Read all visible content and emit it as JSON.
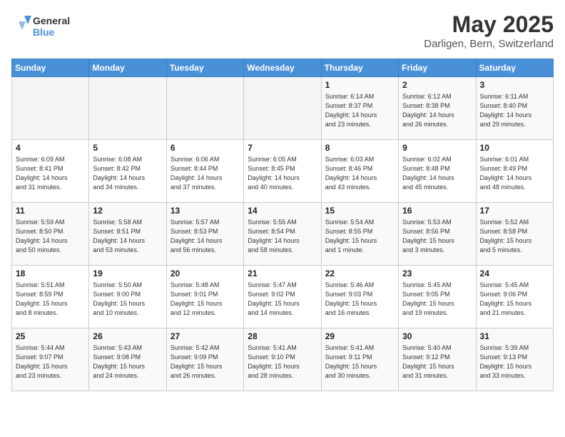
{
  "header": {
    "logo_general": "General",
    "logo_blue": "Blue",
    "month_title": "May 2025",
    "location": "Darligen, Bern, Switzerland"
  },
  "weekdays": [
    "Sunday",
    "Monday",
    "Tuesday",
    "Wednesday",
    "Thursday",
    "Friday",
    "Saturday"
  ],
  "weeks": [
    [
      {
        "day": "",
        "info": ""
      },
      {
        "day": "",
        "info": ""
      },
      {
        "day": "",
        "info": ""
      },
      {
        "day": "",
        "info": ""
      },
      {
        "day": "1",
        "info": "Sunrise: 6:14 AM\nSunset: 8:37 PM\nDaylight: 14 hours\nand 23 minutes."
      },
      {
        "day": "2",
        "info": "Sunrise: 6:12 AM\nSunset: 8:38 PM\nDaylight: 14 hours\nand 26 minutes."
      },
      {
        "day": "3",
        "info": "Sunrise: 6:11 AM\nSunset: 8:40 PM\nDaylight: 14 hours\nand 29 minutes."
      }
    ],
    [
      {
        "day": "4",
        "info": "Sunrise: 6:09 AM\nSunset: 8:41 PM\nDaylight: 14 hours\nand 31 minutes."
      },
      {
        "day": "5",
        "info": "Sunrise: 6:08 AM\nSunset: 8:42 PM\nDaylight: 14 hours\nand 34 minutes."
      },
      {
        "day": "6",
        "info": "Sunrise: 6:06 AM\nSunset: 8:44 PM\nDaylight: 14 hours\nand 37 minutes."
      },
      {
        "day": "7",
        "info": "Sunrise: 6:05 AM\nSunset: 8:45 PM\nDaylight: 14 hours\nand 40 minutes."
      },
      {
        "day": "8",
        "info": "Sunrise: 6:03 AM\nSunset: 8:46 PM\nDaylight: 14 hours\nand 43 minutes."
      },
      {
        "day": "9",
        "info": "Sunrise: 6:02 AM\nSunset: 8:48 PM\nDaylight: 14 hours\nand 45 minutes."
      },
      {
        "day": "10",
        "info": "Sunrise: 6:01 AM\nSunset: 8:49 PM\nDaylight: 14 hours\nand 48 minutes."
      }
    ],
    [
      {
        "day": "11",
        "info": "Sunrise: 5:59 AM\nSunset: 8:50 PM\nDaylight: 14 hours\nand 50 minutes."
      },
      {
        "day": "12",
        "info": "Sunrise: 5:58 AM\nSunset: 8:51 PM\nDaylight: 14 hours\nand 53 minutes."
      },
      {
        "day": "13",
        "info": "Sunrise: 5:57 AM\nSunset: 8:53 PM\nDaylight: 14 hours\nand 56 minutes."
      },
      {
        "day": "14",
        "info": "Sunrise: 5:55 AM\nSunset: 8:54 PM\nDaylight: 14 hours\nand 58 minutes."
      },
      {
        "day": "15",
        "info": "Sunrise: 5:54 AM\nSunset: 8:55 PM\nDaylight: 15 hours\nand 1 minute."
      },
      {
        "day": "16",
        "info": "Sunrise: 5:53 AM\nSunset: 8:56 PM\nDaylight: 15 hours\nand 3 minutes."
      },
      {
        "day": "17",
        "info": "Sunrise: 5:52 AM\nSunset: 8:58 PM\nDaylight: 15 hours\nand 5 minutes."
      }
    ],
    [
      {
        "day": "18",
        "info": "Sunrise: 5:51 AM\nSunset: 8:59 PM\nDaylight: 15 hours\nand 8 minutes."
      },
      {
        "day": "19",
        "info": "Sunrise: 5:50 AM\nSunset: 9:00 PM\nDaylight: 15 hours\nand 10 minutes."
      },
      {
        "day": "20",
        "info": "Sunrise: 5:48 AM\nSunset: 9:01 PM\nDaylight: 15 hours\nand 12 minutes."
      },
      {
        "day": "21",
        "info": "Sunrise: 5:47 AM\nSunset: 9:02 PM\nDaylight: 15 hours\nand 14 minutes."
      },
      {
        "day": "22",
        "info": "Sunrise: 5:46 AM\nSunset: 9:03 PM\nDaylight: 15 hours\nand 16 minutes."
      },
      {
        "day": "23",
        "info": "Sunrise: 5:45 AM\nSunset: 9:05 PM\nDaylight: 15 hours\nand 19 minutes."
      },
      {
        "day": "24",
        "info": "Sunrise: 5:45 AM\nSunset: 9:06 PM\nDaylight: 15 hours\nand 21 minutes."
      }
    ],
    [
      {
        "day": "25",
        "info": "Sunrise: 5:44 AM\nSunset: 9:07 PM\nDaylight: 15 hours\nand 23 minutes."
      },
      {
        "day": "26",
        "info": "Sunrise: 5:43 AM\nSunset: 9:08 PM\nDaylight: 15 hours\nand 24 minutes."
      },
      {
        "day": "27",
        "info": "Sunrise: 5:42 AM\nSunset: 9:09 PM\nDaylight: 15 hours\nand 26 minutes."
      },
      {
        "day": "28",
        "info": "Sunrise: 5:41 AM\nSunset: 9:10 PM\nDaylight: 15 hours\nand 28 minutes."
      },
      {
        "day": "29",
        "info": "Sunrise: 5:41 AM\nSunset: 9:11 PM\nDaylight: 15 hours\nand 30 minutes."
      },
      {
        "day": "30",
        "info": "Sunrise: 5:40 AM\nSunset: 9:12 PM\nDaylight: 15 hours\nand 31 minutes."
      },
      {
        "day": "31",
        "info": "Sunrise: 5:39 AM\nSunset: 9:13 PM\nDaylight: 15 hours\nand 33 minutes."
      }
    ]
  ]
}
